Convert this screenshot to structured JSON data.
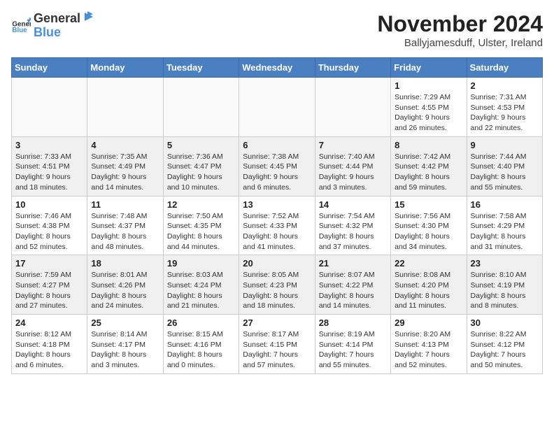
{
  "logo": {
    "general": "General",
    "blue": "Blue"
  },
  "title": "November 2024",
  "subtitle": "Ballyjamesduff, Ulster, Ireland",
  "weekdays": [
    "Sunday",
    "Monday",
    "Tuesday",
    "Wednesday",
    "Thursday",
    "Friday",
    "Saturday"
  ],
  "weeks": [
    [
      {
        "day": "",
        "info": ""
      },
      {
        "day": "",
        "info": ""
      },
      {
        "day": "",
        "info": ""
      },
      {
        "day": "",
        "info": ""
      },
      {
        "day": "",
        "info": ""
      },
      {
        "day": "1",
        "info": "Sunrise: 7:29 AM\nSunset: 4:55 PM\nDaylight: 9 hours\nand 26 minutes."
      },
      {
        "day": "2",
        "info": "Sunrise: 7:31 AM\nSunset: 4:53 PM\nDaylight: 9 hours\nand 22 minutes."
      }
    ],
    [
      {
        "day": "3",
        "info": "Sunrise: 7:33 AM\nSunset: 4:51 PM\nDaylight: 9 hours\nand 18 minutes."
      },
      {
        "day": "4",
        "info": "Sunrise: 7:35 AM\nSunset: 4:49 PM\nDaylight: 9 hours\nand 14 minutes."
      },
      {
        "day": "5",
        "info": "Sunrise: 7:36 AM\nSunset: 4:47 PM\nDaylight: 9 hours\nand 10 minutes."
      },
      {
        "day": "6",
        "info": "Sunrise: 7:38 AM\nSunset: 4:45 PM\nDaylight: 9 hours\nand 6 minutes."
      },
      {
        "day": "7",
        "info": "Sunrise: 7:40 AM\nSunset: 4:44 PM\nDaylight: 9 hours\nand 3 minutes."
      },
      {
        "day": "8",
        "info": "Sunrise: 7:42 AM\nSunset: 4:42 PM\nDaylight: 8 hours\nand 59 minutes."
      },
      {
        "day": "9",
        "info": "Sunrise: 7:44 AM\nSunset: 4:40 PM\nDaylight: 8 hours\nand 55 minutes."
      }
    ],
    [
      {
        "day": "10",
        "info": "Sunrise: 7:46 AM\nSunset: 4:38 PM\nDaylight: 8 hours\nand 52 minutes."
      },
      {
        "day": "11",
        "info": "Sunrise: 7:48 AM\nSunset: 4:37 PM\nDaylight: 8 hours\nand 48 minutes."
      },
      {
        "day": "12",
        "info": "Sunrise: 7:50 AM\nSunset: 4:35 PM\nDaylight: 8 hours\nand 44 minutes."
      },
      {
        "day": "13",
        "info": "Sunrise: 7:52 AM\nSunset: 4:33 PM\nDaylight: 8 hours\nand 41 minutes."
      },
      {
        "day": "14",
        "info": "Sunrise: 7:54 AM\nSunset: 4:32 PM\nDaylight: 8 hours\nand 37 minutes."
      },
      {
        "day": "15",
        "info": "Sunrise: 7:56 AM\nSunset: 4:30 PM\nDaylight: 8 hours\nand 34 minutes."
      },
      {
        "day": "16",
        "info": "Sunrise: 7:58 AM\nSunset: 4:29 PM\nDaylight: 8 hours\nand 31 minutes."
      }
    ],
    [
      {
        "day": "17",
        "info": "Sunrise: 7:59 AM\nSunset: 4:27 PM\nDaylight: 8 hours\nand 27 minutes."
      },
      {
        "day": "18",
        "info": "Sunrise: 8:01 AM\nSunset: 4:26 PM\nDaylight: 8 hours\nand 24 minutes."
      },
      {
        "day": "19",
        "info": "Sunrise: 8:03 AM\nSunset: 4:24 PM\nDaylight: 8 hours\nand 21 minutes."
      },
      {
        "day": "20",
        "info": "Sunrise: 8:05 AM\nSunset: 4:23 PM\nDaylight: 8 hours\nand 18 minutes."
      },
      {
        "day": "21",
        "info": "Sunrise: 8:07 AM\nSunset: 4:22 PM\nDaylight: 8 hours\nand 14 minutes."
      },
      {
        "day": "22",
        "info": "Sunrise: 8:08 AM\nSunset: 4:20 PM\nDaylight: 8 hours\nand 11 minutes."
      },
      {
        "day": "23",
        "info": "Sunrise: 8:10 AM\nSunset: 4:19 PM\nDaylight: 8 hours\nand 8 minutes."
      }
    ],
    [
      {
        "day": "24",
        "info": "Sunrise: 8:12 AM\nSunset: 4:18 PM\nDaylight: 8 hours\nand 6 minutes."
      },
      {
        "day": "25",
        "info": "Sunrise: 8:14 AM\nSunset: 4:17 PM\nDaylight: 8 hours\nand 3 minutes."
      },
      {
        "day": "26",
        "info": "Sunrise: 8:15 AM\nSunset: 4:16 PM\nDaylight: 8 hours\nand 0 minutes."
      },
      {
        "day": "27",
        "info": "Sunrise: 8:17 AM\nSunset: 4:15 PM\nDaylight: 7 hours\nand 57 minutes."
      },
      {
        "day": "28",
        "info": "Sunrise: 8:19 AM\nSunset: 4:14 PM\nDaylight: 7 hours\nand 55 minutes."
      },
      {
        "day": "29",
        "info": "Sunrise: 8:20 AM\nSunset: 4:13 PM\nDaylight: 7 hours\nand 52 minutes."
      },
      {
        "day": "30",
        "info": "Sunrise: 8:22 AM\nSunset: 4:12 PM\nDaylight: 7 hours\nand 50 minutes."
      }
    ]
  ]
}
